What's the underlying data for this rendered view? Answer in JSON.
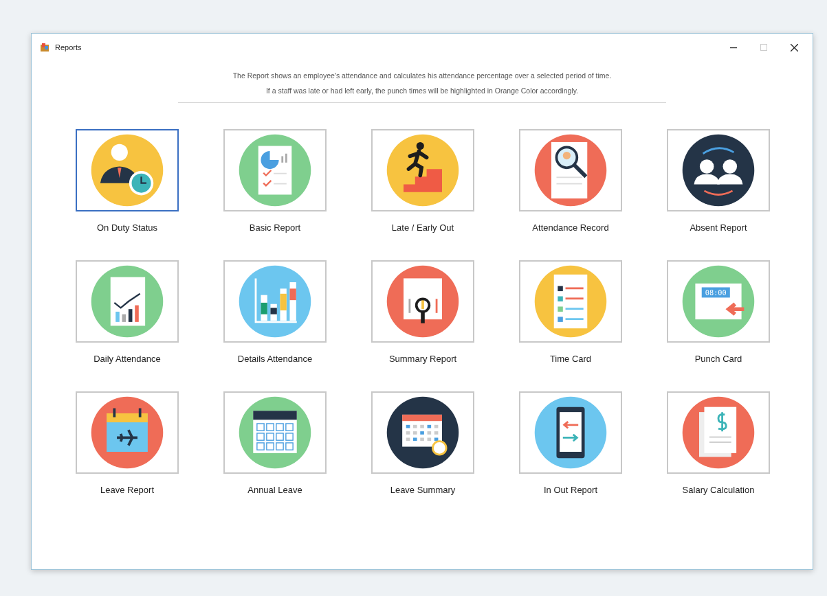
{
  "window": {
    "title": "Reports",
    "maximize_disabled": true
  },
  "description": [
    "The Report shows an employee's attendance and calculates his attendance percentage over a selected period of time.",
    "If a staff was late or had left early, the punch times will be highlighted in Orange Color accordingly."
  ],
  "reports": [
    {
      "label": "On Duty Status",
      "kind": "person-clock",
      "color": "#f7c340",
      "selected": true
    },
    {
      "label": "Basic Report",
      "kind": "document-pie",
      "color": "#7fcf8e",
      "selected": false
    },
    {
      "label": "Late / Early Out",
      "kind": "runner-stairs",
      "color": "#f7c340",
      "selected": false
    },
    {
      "label": "Attendance Record",
      "kind": "document-magnifier",
      "color": "#ef6c57",
      "selected": false
    },
    {
      "label": "Absent Report",
      "kind": "two-people",
      "color": "#243447",
      "selected": false
    },
    {
      "label": "Daily Attendance",
      "kind": "document-line-chart",
      "color": "#7fcf8e",
      "selected": false
    },
    {
      "label": "Details Attendance",
      "kind": "bar-chart",
      "color": "#6cc6ef",
      "selected": false
    },
    {
      "label": "Summary Report",
      "kind": "screen-magnifier",
      "color": "#ef6c57",
      "selected": false
    },
    {
      "label": "Time Card",
      "kind": "checklist",
      "color": "#f7c340",
      "selected": false
    },
    {
      "label": "Punch Card",
      "kind": "clock-card",
      "color": "#7fcf8e",
      "selected": false,
      "display": "08:00"
    },
    {
      "label": "Leave Report",
      "kind": "calendar-plane",
      "color": "#ef6c57",
      "selected": false
    },
    {
      "label": "Annual Leave",
      "kind": "calendar-grid",
      "color": "#7fcf8e",
      "selected": false
    },
    {
      "label": "Leave Summary",
      "kind": "calendar-clock",
      "color": "#243447",
      "selected": false
    },
    {
      "label": "In Out Report",
      "kind": "tablet-arrows",
      "color": "#6cc6ef",
      "selected": false
    },
    {
      "label": "Salary Calculation",
      "kind": "dollar-document",
      "color": "#ef6c57",
      "selected": false
    }
  ]
}
